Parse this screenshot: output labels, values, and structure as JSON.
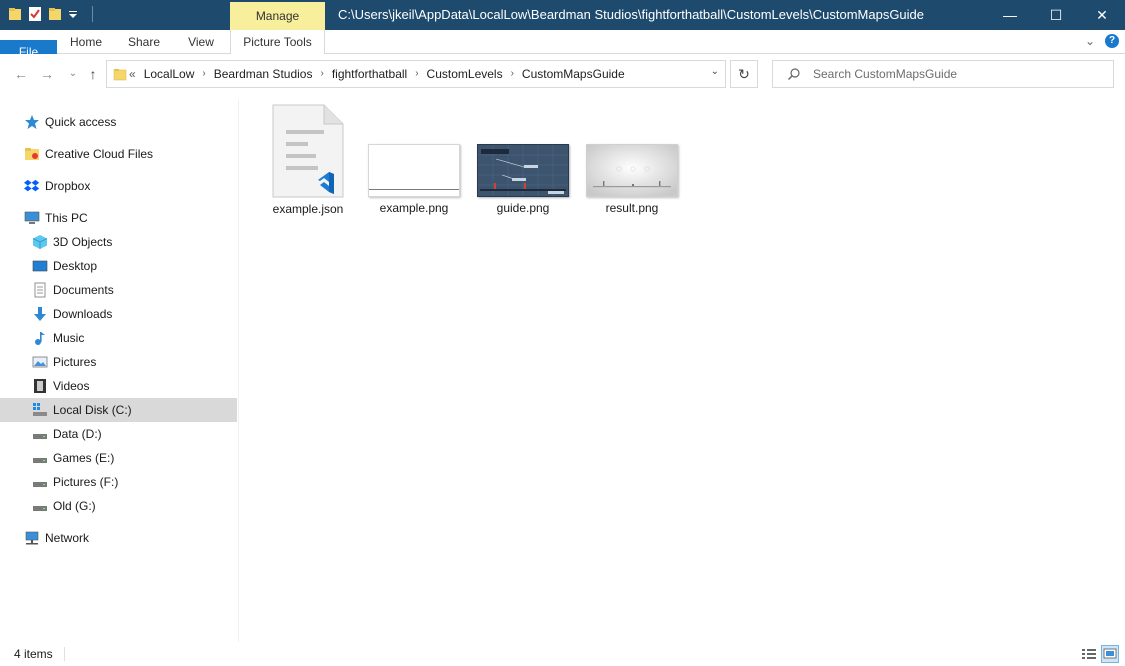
{
  "window": {
    "title": "C:\\Users\\jkeil\\AppData\\LocalLow\\Beardman Studios\\fightforthatball\\CustomLevels\\CustomMapsGuide",
    "context_tab": "Manage",
    "minimize": "—",
    "maximize": "☐",
    "close": "✕"
  },
  "ribbon": {
    "tabs": [
      "File",
      "Home",
      "Share",
      "View",
      "Picture Tools"
    ],
    "expand": "⌄",
    "help": "?"
  },
  "nav": {
    "back": "←",
    "forward": "→",
    "recent": "⌄",
    "up": "↑",
    "overflow": "«",
    "breadcrumbs": [
      "LocalLow",
      "Beardman Studios",
      "fightforthatball",
      "CustomLevels",
      "CustomMapsGuide"
    ],
    "refresh": "↻",
    "search_placeholder": "Search CustomMapsGuide"
  },
  "sidebar": {
    "items": [
      {
        "label": "Quick access",
        "icon": "star-icon"
      },
      {
        "label": "Creative Cloud Files",
        "icon": "creative-cloud-folder-icon"
      },
      {
        "label": "Dropbox",
        "icon": "dropbox-icon"
      },
      {
        "label": "This PC",
        "icon": "computer-icon"
      },
      {
        "label": "3D Objects",
        "icon": "cube-icon"
      },
      {
        "label": "Desktop",
        "icon": "desktop-icon"
      },
      {
        "label": "Documents",
        "icon": "documents-icon"
      },
      {
        "label": "Downloads",
        "icon": "download-arrow-icon"
      },
      {
        "label": "Music",
        "icon": "music-note-icon"
      },
      {
        "label": "Pictures",
        "icon": "pictures-icon"
      },
      {
        "label": "Videos",
        "icon": "film-icon"
      },
      {
        "label": "Local Disk (C:)",
        "icon": "windows-drive-icon"
      },
      {
        "label": "Data (D:)",
        "icon": "drive-icon"
      },
      {
        "label": "Games (E:)",
        "icon": "drive-icon"
      },
      {
        "label": "Pictures (F:)",
        "icon": "drive-icon"
      },
      {
        "label": "Old (G:)",
        "icon": "drive-icon"
      },
      {
        "label": "Network",
        "icon": "network-icon"
      }
    ]
  },
  "files": [
    {
      "name": "example.json",
      "type": "json"
    },
    {
      "name": "example.png",
      "type": "png-blank"
    },
    {
      "name": "guide.png",
      "type": "png-guide"
    },
    {
      "name": "result.png",
      "type": "png-result"
    }
  ],
  "status": {
    "count": "4 items"
  },
  "colors": {
    "titlebar": "#1e4a6e",
    "manage_tab": "#f7ef9c",
    "file_tab": "#1979ca",
    "selected_nav": "#d9d9d9",
    "vscode_blue": "#1e7bd2"
  }
}
